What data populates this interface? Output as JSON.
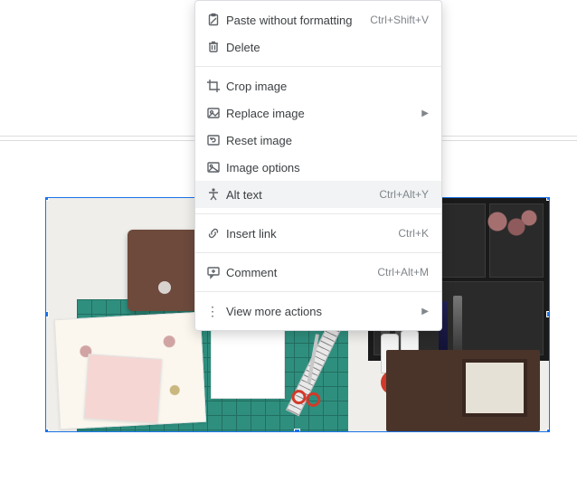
{
  "menu": {
    "highlighted_index": 6,
    "items": [
      {
        "label": "Paste without formatting",
        "shortcut": "Ctrl+Shift+V",
        "icon": "paste-no-format-icon"
      },
      {
        "label": "Delete",
        "icon": "trash-icon"
      },
      {
        "label": "Crop image",
        "icon": "crop-icon"
      },
      {
        "label": "Replace image",
        "icon": "replace-image-icon",
        "submenu": true
      },
      {
        "label": "Reset image",
        "icon": "reset-image-icon"
      },
      {
        "label": "Image options",
        "icon": "image-options-icon"
      },
      {
        "label": "Alt text",
        "shortcut": "Ctrl+Alt+Y",
        "icon": "accessibility-icon"
      },
      {
        "label": "Insert link",
        "shortcut": "Ctrl+K",
        "icon": "link-icon"
      },
      {
        "label": "Comment",
        "shortcut": "Ctrl+Alt+M",
        "icon": "comment-icon"
      },
      {
        "label": "View more actions",
        "icon": "more-icon",
        "submenu": true
      }
    ]
  },
  "selection": {
    "type": "image",
    "handles": [
      "tl",
      "t",
      "tr",
      "l",
      "r",
      "bl",
      "b",
      "br"
    ],
    "border_color": "#1a73e8"
  }
}
